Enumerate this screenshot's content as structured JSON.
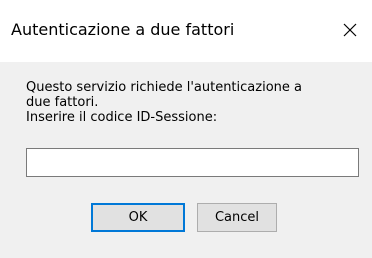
{
  "window": {
    "title": "Autenticazione a due fattori",
    "close_icon": "close-icon"
  },
  "dialog": {
    "message_line1": "Questo servizio richiede l'autenticazione a",
    "message_line2": "due fattori.",
    "prompt": "Inserire il codice ID-Sessione:",
    "input_value": "",
    "ok_label": "OK",
    "cancel_label": "Cancel"
  },
  "colors": {
    "title_background": "#ffffff",
    "client_background": "#f0f0f0",
    "default_button_accent": "#0078d7"
  }
}
